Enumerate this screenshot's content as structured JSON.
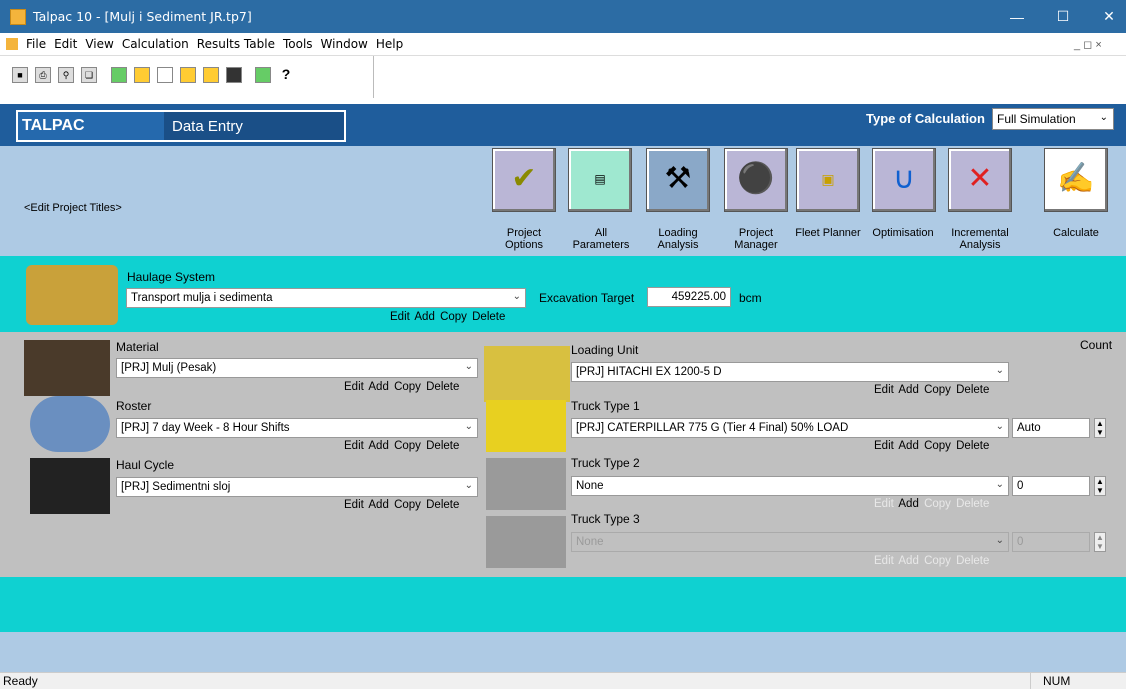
{
  "window": {
    "title": "Talpac 10 - [Mulj i Sediment JR.tp7]"
  },
  "menu": [
    "File",
    "Edit",
    "View",
    "Calculation",
    "Results Table",
    "Tools",
    "Window",
    "Help"
  ],
  "header": {
    "app": "TALPAC",
    "mode": "Data Entry",
    "calc_label": "Type of Calculation",
    "calc_value": "Full Simulation"
  },
  "project": {
    "titles_link": "<Edit Project Titles>"
  },
  "big_buttons": [
    {
      "label": "Project Options"
    },
    {
      "label": "All Parameters"
    },
    {
      "label": "Loading Analysis"
    },
    {
      "label": "Project Manager"
    },
    {
      "label": "Fleet Planner"
    },
    {
      "label": "Optimisation"
    },
    {
      "label": "Incremental Analysis"
    },
    {
      "label": "Calculate"
    }
  ],
  "haulage": {
    "label": "Haulage System",
    "value": "Transport mulja i sedimenta",
    "edit": "Edit",
    "add": "Add",
    "copy": "Copy",
    "delete": "Delete",
    "target_label": "Excavation Target",
    "target_value": "459225.00",
    "target_unit": "bcm"
  },
  "material": {
    "label": "Material",
    "value": "[PRJ] Mulj (Pesak)"
  },
  "roster": {
    "label": "Roster",
    "value": "[PRJ] 7 day Week - 8 Hour Shifts"
  },
  "haulcycle": {
    "label": "Haul Cycle",
    "value": "[PRJ] Sedimentni sloj"
  },
  "loading": {
    "label": "Loading Unit",
    "value": "[PRJ] HITACHI EX 1200-5 D"
  },
  "count_label": "Count",
  "truck1": {
    "label": "Truck Type 1",
    "value": "[PRJ] CATERPILLAR 775 G (Tier 4 Final) 50% LOAD",
    "count": "Auto"
  },
  "truck2": {
    "label": "Truck Type 2",
    "value": "None",
    "count": "0"
  },
  "truck3": {
    "label": "Truck Type 3",
    "value": "None",
    "count": "0"
  },
  "links": {
    "edit": "Edit",
    "add": "Add",
    "copy": "Copy",
    "delete": "Delete"
  },
  "status": {
    "left": "Ready",
    "num": "NUM"
  }
}
